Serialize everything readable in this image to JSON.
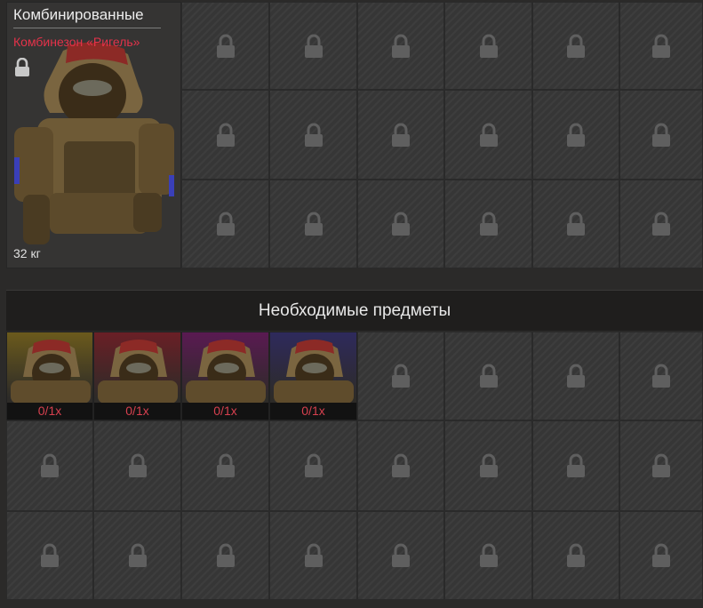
{
  "item": {
    "category": "Комбинированные",
    "name": "Комбинезон «Ригель»",
    "weight": "32 кг"
  },
  "required_section": {
    "title": "Необходимые предметы",
    "items": [
      {
        "count": "0/1x",
        "rarity_color": "#6b5a1c"
      },
      {
        "count": "0/1x",
        "rarity_color": "#6a1f26"
      },
      {
        "count": "0/1x",
        "rarity_color": "#5a1a52"
      },
      {
        "count": "0/1x",
        "rarity_color": "#2e2a5c"
      }
    ]
  },
  "colors": {
    "name_red": "#e4324a",
    "count_red": "#d6404f",
    "lock_gray": "#5f5f5f"
  },
  "icons": {
    "slot_lock": "padlock-icon",
    "item_lock": "padlock-icon"
  }
}
